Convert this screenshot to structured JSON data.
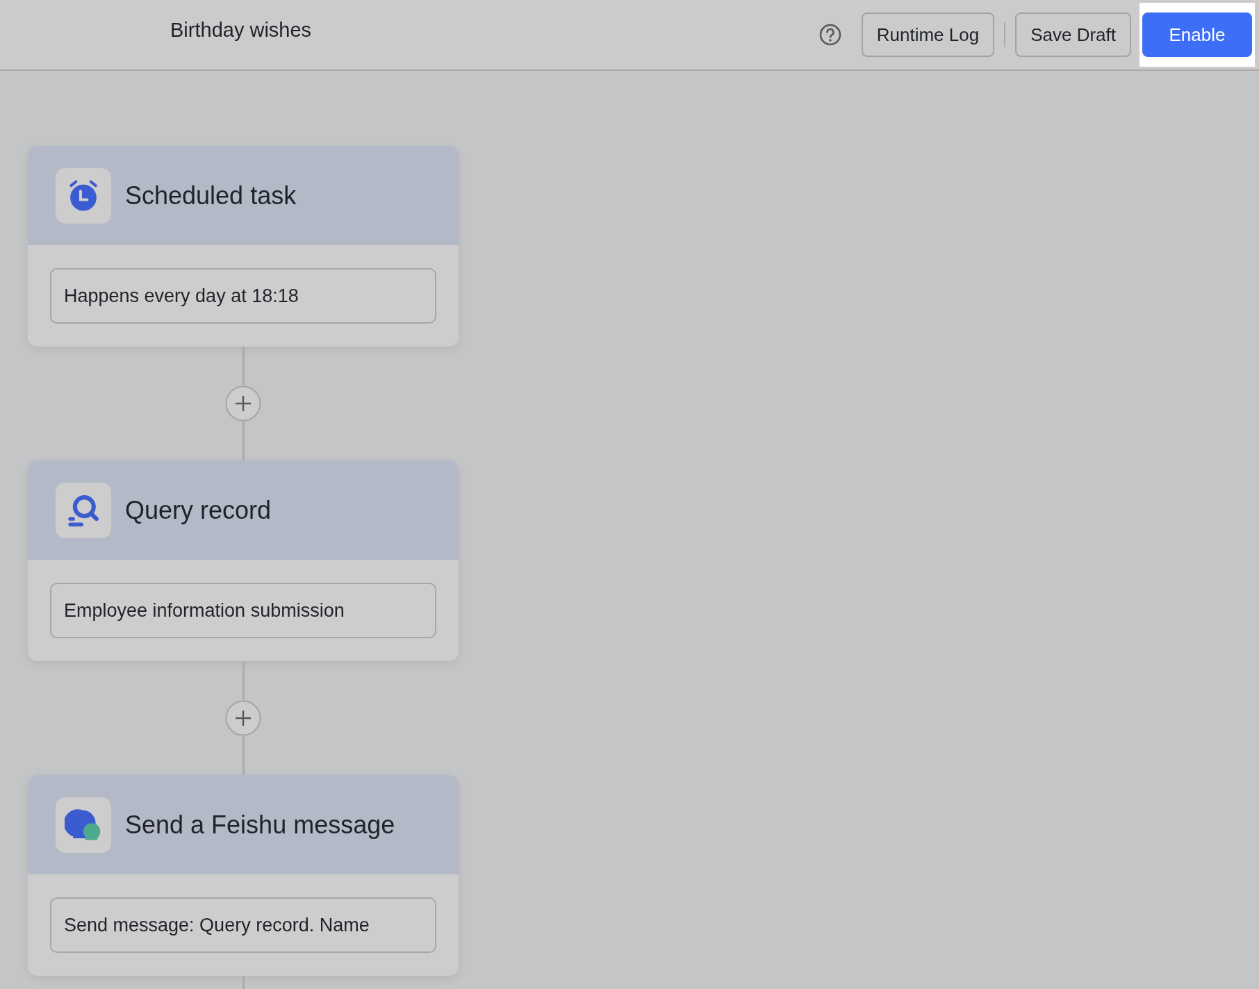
{
  "window": {
    "title": "Birthday wishes"
  },
  "toolbar": {
    "buttons": [
      {
        "label": "Runtime Log",
        "kind": "outline",
        "highlighted": false
      },
      {
        "label": "Save Draft",
        "kind": "outline",
        "highlighted": false
      },
      {
        "label": "Enable",
        "kind": "primary",
        "highlighted": true
      }
    ]
  },
  "nodes": [
    {
      "kind": "schedule",
      "title": "Scheduled task",
      "summary": "Happens every day at 18:18"
    },
    {
      "kind": "query",
      "title": "Query record",
      "summary": "Employee information submission"
    },
    {
      "kind": "message",
      "title": "Send a Feishu message",
      "summary": "Send message: Query record. Name"
    }
  ]
}
